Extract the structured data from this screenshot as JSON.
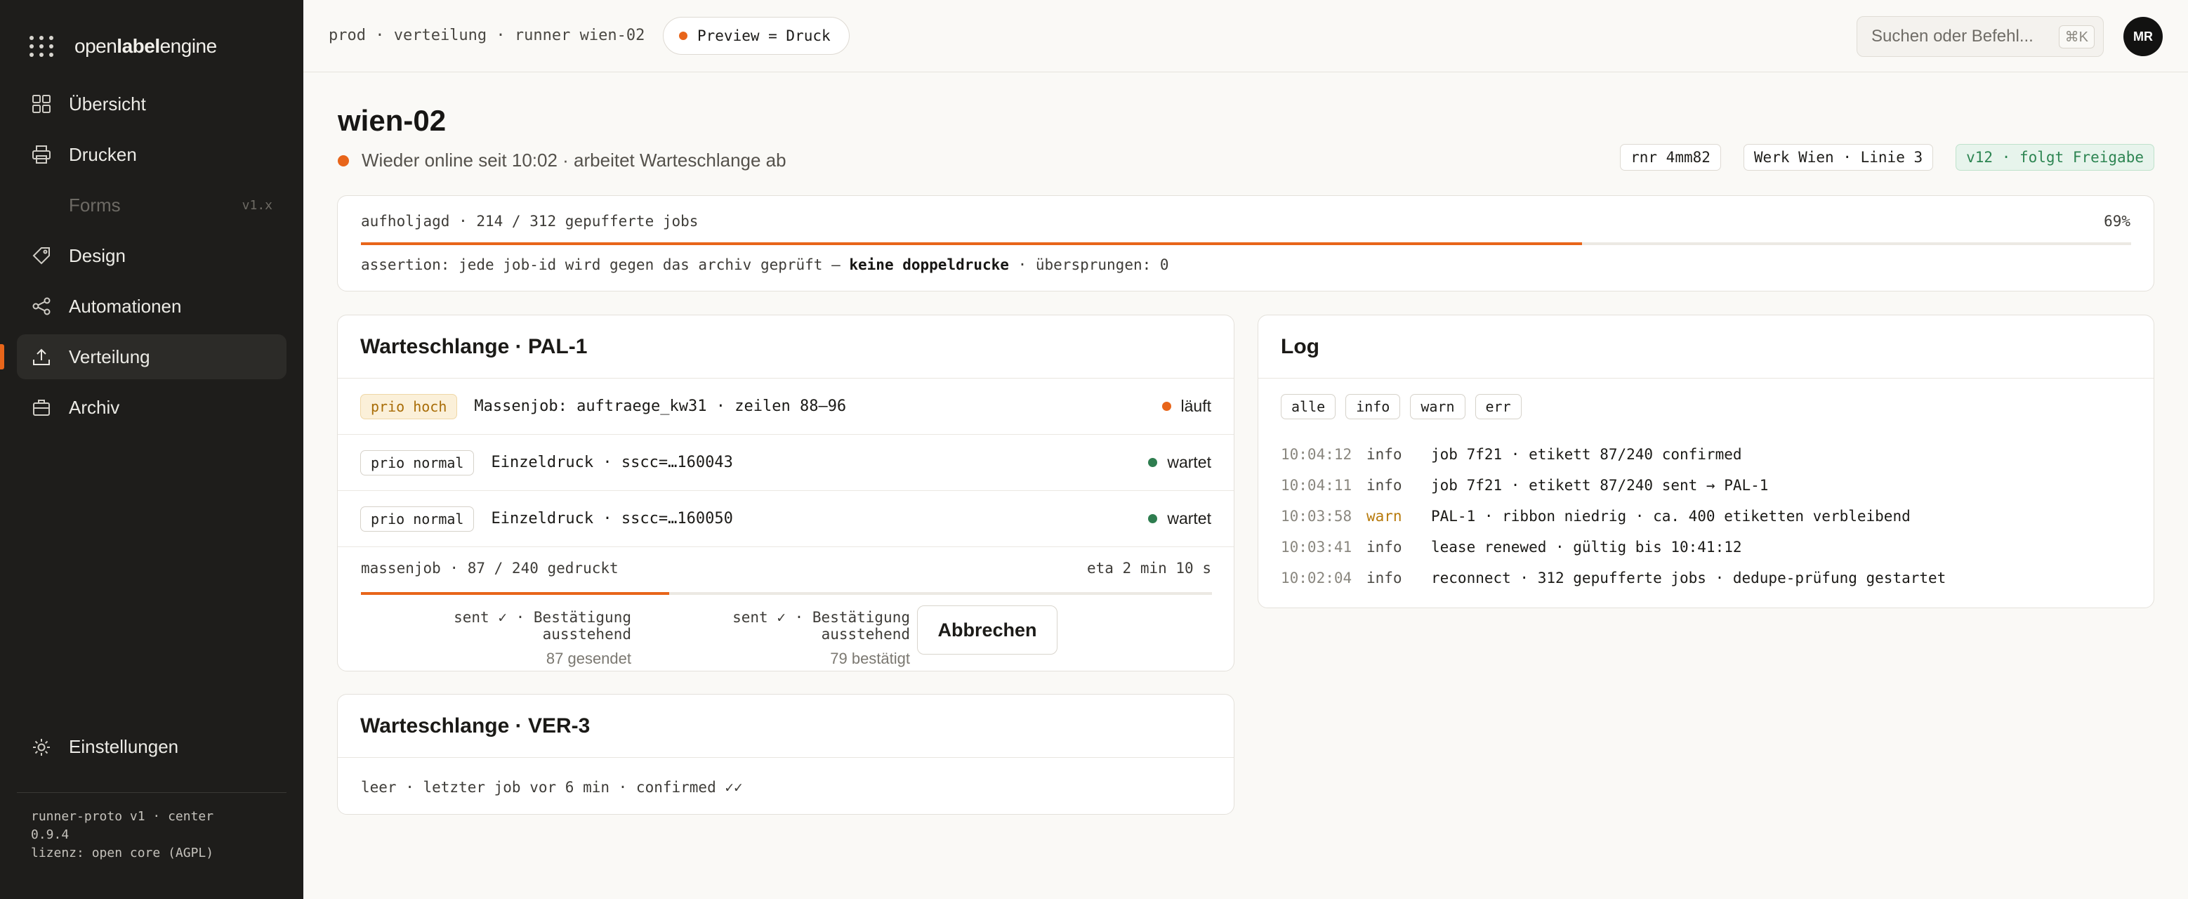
{
  "sidebar": {
    "logo": {
      "pre": "open",
      "bold": "label",
      "post": "engine"
    },
    "items": [
      {
        "label": "Übersicht",
        "icon": "grid-icon"
      },
      {
        "label": "Drucken",
        "icon": "printer-icon"
      },
      {
        "label": "Forms",
        "icon": "document-icon",
        "badge": "v1.x",
        "disabled": true
      },
      {
        "label": "Design",
        "icon": "tag-icon"
      },
      {
        "label": "Automationen",
        "icon": "share-nodes-icon"
      },
      {
        "label": "Verteilung",
        "icon": "upload-icon",
        "active": true
      },
      {
        "label": "Archiv",
        "icon": "briefcase-icon"
      }
    ],
    "settings_label": "Einstellungen",
    "footer": [
      "runner-proto v1 · center",
      "0.9.4",
      "lizenz: open core (AGPL)"
    ]
  },
  "topbar": {
    "breadcrumb": "prod · verteilung · runner wien-02",
    "preview_label": "Preview = Druck",
    "search_placeholder": "Suchen oder Befehl...",
    "search_shortcut": "⌘K",
    "avatar_initials": "MR"
  },
  "header": {
    "title": "wien-02",
    "status": "Wieder online seit 10:02 · arbeitet Warteschlange ab",
    "tags": [
      "rnr 4mm82",
      "Werk Wien · Linie 3",
      "v12 · folgt Freigabe"
    ]
  },
  "catchup": {
    "label": "aufholjagd · 214 / 312 gepufferte jobs",
    "percent_label": "69%",
    "progress": 0.69,
    "assertion_pre": "assertion: jede job-id wird gegen das archiv geprüft — ",
    "assertion_bold": "keine doppeldrucke",
    "assertion_post": " · übersprungen: 0"
  },
  "queue_pal": {
    "title": "Warteschlange · PAL-1",
    "rows": [
      {
        "prio": "prio hoch",
        "text": "Massenjob: auftraege_kw31 · zeilen 88–96",
        "status": "läuft",
        "status_color": "#e8651a"
      },
      {
        "prio": "prio normal",
        "text": "Einzeldruck · sscc=…160043",
        "status": "wartet",
        "status_color": "#2e7d4f"
      },
      {
        "prio": "prio normal",
        "text": "Einzeldruck · sscc=…160050",
        "status": "wartet",
        "status_color": "#2e7d4f"
      }
    ],
    "massjob_label": "massenjob · 87 / 240 gedruckt",
    "eta": "eta 2 min 10 s",
    "progress": 0.3625,
    "stat_sent": {
      "label": "sent ✓ · Bestätigung ausstehend",
      "sub": "87 gesendet"
    },
    "stat_confirmed": {
      "label": "sent ✓ · Bestätigung ausstehend",
      "sub": "79 bestätigt"
    },
    "abort_label": "Abbrechen"
  },
  "queue_ver": {
    "title": "Warteschlange · VER-3",
    "text": "leer · letzter job vor 6 min · confirmed ✓✓"
  },
  "log": {
    "title": "Log",
    "filters": [
      "alle",
      "info",
      "warn",
      "err"
    ],
    "lines": [
      {
        "time": "10:04:12",
        "level": "info",
        "msg": "job 7f21 · etikett 87/240 confirmed"
      },
      {
        "time": "10:04:11",
        "level": "info",
        "msg": "job 7f21 · etikett 87/240 sent → PAL-1"
      },
      {
        "time": "10:03:58",
        "level": "warn",
        "msg": "PAL-1 · ribbon niedrig · ca. 400 etiketten verbleibend"
      },
      {
        "time": "10:03:41",
        "level": "info",
        "msg": "lease renewed · gültig bis 10:41:12"
      },
      {
        "time": "10:02:04",
        "level": "info",
        "msg": "reconnect · 312 gepufferte jobs · dedupe-prüfung gestartet"
      }
    ]
  },
  "colors": {
    "accent": "#e8651a",
    "ok": "#2e7d4f",
    "warn": "#b77a0c"
  }
}
